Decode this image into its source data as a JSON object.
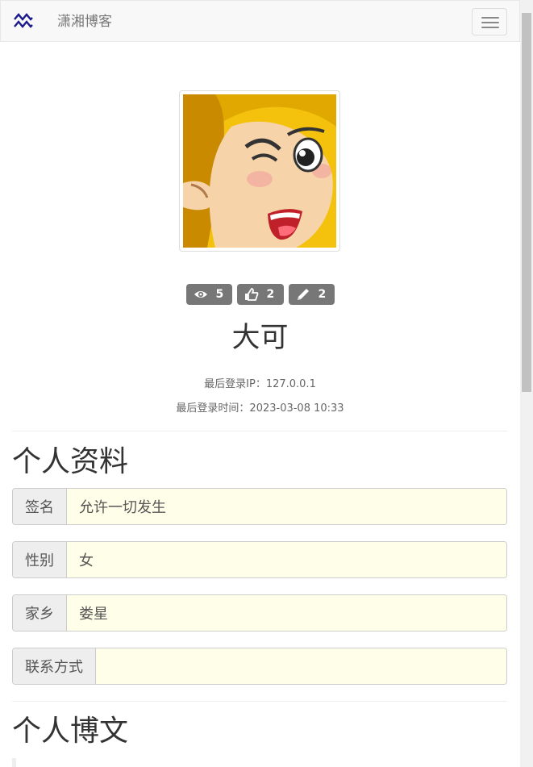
{
  "navbar": {
    "brand": "潇湘博客",
    "logo_icon": "wave-logo-icon",
    "menu_icon": "hamburger-menu-icon"
  },
  "profile": {
    "avatar_icon": "cartoon-avatar-image",
    "stats": [
      {
        "icon": "eye-icon",
        "value": "5"
      },
      {
        "icon": "thumbs-up-icon",
        "value": "2"
      },
      {
        "icon": "pencil-icon",
        "value": "2"
      }
    ],
    "username": "大可",
    "last_login_ip": "最后登录IP：127.0.0.1",
    "last_login_time": "最后登录时间：2023-03-08 10:33"
  },
  "personal_info": {
    "title": "个人资料",
    "fields": [
      {
        "label": "签名",
        "value": "允许一切发生"
      },
      {
        "label": "性别",
        "value": "女"
      },
      {
        "label": "家乡",
        "value": "娄星"
      },
      {
        "label": "联系方式",
        "value": ""
      }
    ]
  },
  "blogs": {
    "title": "个人博文"
  },
  "colors": {
    "badge": "#777777",
    "field_bg": "#fefee9",
    "addon_bg": "#eeeeee",
    "navbar_bg": "#f8f8f8"
  }
}
